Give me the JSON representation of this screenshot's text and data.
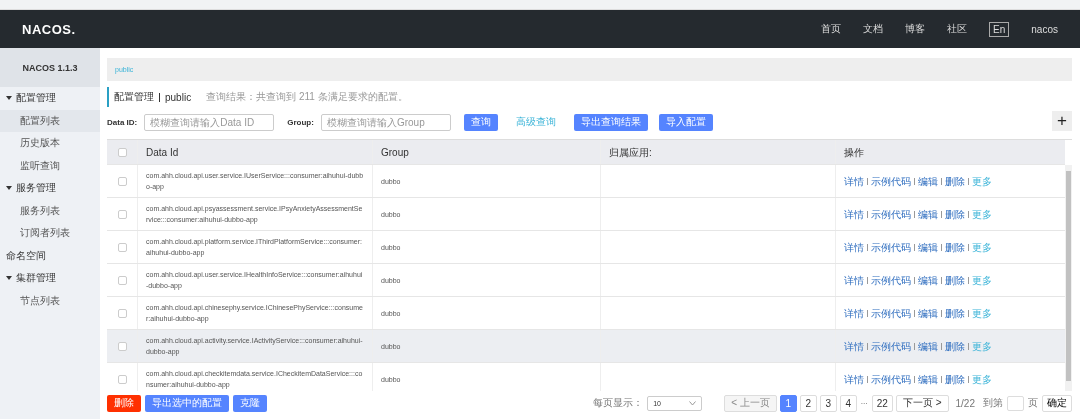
{
  "header": {
    "logo": "NACOS.",
    "nav": [
      {
        "label": "首页",
        "kind": "link"
      },
      {
        "label": "文档",
        "kind": "link"
      },
      {
        "label": "博客",
        "kind": "link"
      },
      {
        "label": "社区",
        "kind": "link"
      },
      {
        "label": "En",
        "kind": "lang"
      },
      {
        "label": "nacos",
        "kind": "user"
      }
    ]
  },
  "sidebar": {
    "title": "NACOS 1.1.3",
    "items": [
      {
        "label": "配置管理",
        "expanded": true,
        "children": [
          {
            "label": "配置列表",
            "selected": true
          },
          {
            "label": "历史版本",
            "selected": false
          },
          {
            "label": "监听查询",
            "selected": false
          }
        ]
      },
      {
        "label": "服务管理",
        "expanded": true,
        "children": [
          {
            "label": "服务列表",
            "selected": false
          },
          {
            "label": "订阅者列表",
            "selected": false
          }
        ]
      },
      {
        "label": "命名空间"
      },
      {
        "label": "集群管理",
        "expanded": true,
        "children": [
          {
            "label": "节点列表",
            "selected": false
          }
        ]
      }
    ]
  },
  "breadcrumb": "public",
  "page_title": {
    "title": "配置管理",
    "namespace": "public",
    "summary": "查询结果：共查询到 211 条满足要求的配置。"
  },
  "search": {
    "fields": [
      {
        "label": "Data ID:",
        "placeholder": "模糊查询请输入Data ID"
      },
      {
        "label": "Group:",
        "placeholder": "模糊查询请输入Group"
      }
    ],
    "buttons": [
      {
        "label": "查询",
        "kind": "primary"
      },
      {
        "label": "高级查询",
        "kind": "link"
      },
      {
        "label": "导出查询结果",
        "kind": "primary"
      },
      {
        "label": "导入配置",
        "kind": "primary"
      }
    ],
    "add_button": "+"
  },
  "table": {
    "columns": [
      "Data Id",
      "Group",
      "归属应用:",
      "操作"
    ],
    "select_all": false,
    "rows": [
      {
        "data_id": "com.ahh.cloud.api.user.service.IUserService:::consumer:aihuhui-dubbo-app",
        "group": "dubbo",
        "checked": false,
        "highlighted": false,
        "actions": [
          {
            "label": "详情",
            "kind": "link"
          },
          {
            "label": "示例代码",
            "kind": "link"
          },
          {
            "label": "编辑",
            "kind": "link"
          },
          {
            "label": "删除",
            "kind": "link"
          },
          {
            "label": "更多",
            "kind": "more"
          }
        ]
      },
      {
        "data_id": "com.ahh.cloud.api.psyassessment.service.IPsyAnxietyAssessmentService:::consumer:aihuhui-dubbo-app",
        "group": "dubbo",
        "checked": false,
        "highlighted": false,
        "actions": [
          {
            "label": "详情",
            "kind": "link"
          },
          {
            "label": "示例代码",
            "kind": "link"
          },
          {
            "label": "编辑",
            "kind": "link"
          },
          {
            "label": "删除",
            "kind": "link"
          },
          {
            "label": "更多",
            "kind": "more"
          }
        ]
      },
      {
        "data_id": "com.ahh.cloud.api.platform.service.IThirdPlatformService:::consumer:aihuhui-dubbo-app",
        "group": "dubbo",
        "checked": false,
        "highlighted": false,
        "actions": [
          {
            "label": "详情",
            "kind": "link"
          },
          {
            "label": "示例代码",
            "kind": "link"
          },
          {
            "label": "编辑",
            "kind": "link"
          },
          {
            "label": "删除",
            "kind": "link"
          },
          {
            "label": "更多",
            "kind": "more"
          }
        ]
      },
      {
        "data_id": "com.ahh.cloud.api.user.service.IHealthInfoService:::consumer:aihuhui-dubbo-app",
        "group": "dubbo",
        "checked": false,
        "highlighted": false,
        "actions": [
          {
            "label": "详情",
            "kind": "link"
          },
          {
            "label": "示例代码",
            "kind": "link"
          },
          {
            "label": "编辑",
            "kind": "link"
          },
          {
            "label": "删除",
            "kind": "link"
          },
          {
            "label": "更多",
            "kind": "more"
          }
        ]
      },
      {
        "data_id": "com.ahh.cloud.api.chinesephy.service.IChinesePhyService:::consumer:aihuhui-dubbo-app",
        "group": "dubbo",
        "checked": false,
        "highlighted": false,
        "actions": [
          {
            "label": "详情",
            "kind": "link"
          },
          {
            "label": "示例代码",
            "kind": "link"
          },
          {
            "label": "编辑",
            "kind": "link"
          },
          {
            "label": "删除",
            "kind": "link"
          },
          {
            "label": "更多",
            "kind": "more"
          }
        ]
      },
      {
        "data_id": "com.ahh.cloud.api.activity.service.IActivityService:::consumer:aihuhui-dubbo-app",
        "group": "dubbo",
        "checked": false,
        "highlighted": true,
        "actions": [
          {
            "label": "详情",
            "kind": "link"
          },
          {
            "label": "示例代码",
            "kind": "link"
          },
          {
            "label": "编辑",
            "kind": "link"
          },
          {
            "label": "删除",
            "kind": "link"
          },
          {
            "label": "更多",
            "kind": "more"
          }
        ]
      },
      {
        "data_id": "com.ahh.cloud.api.checkitemdata.service.ICheckitemDataService:::consumer:aihuhui-dubbo-app",
        "group": "dubbo",
        "checked": false,
        "highlighted": false,
        "actions": [
          {
            "label": "详情",
            "kind": "link"
          },
          {
            "label": "示例代码",
            "kind": "link"
          },
          {
            "label": "编辑",
            "kind": "link"
          },
          {
            "label": "删除",
            "kind": "link"
          },
          {
            "label": "更多",
            "kind": "more"
          }
        ]
      }
    ]
  },
  "footer": {
    "buttons": [
      {
        "label": "删除",
        "kind": "danger"
      },
      {
        "label": "导出选中的配置",
        "kind": "primary"
      },
      {
        "label": "克隆",
        "kind": "primary"
      }
    ],
    "page_size_label": "每页显示：",
    "page_size": "10",
    "pager": [
      {
        "label": "< 上一页",
        "kind": "nav",
        "disabled": true
      },
      {
        "label": "1",
        "kind": "page",
        "selected": true
      },
      {
        "label": "2",
        "kind": "page",
        "selected": false
      },
      {
        "label": "3",
        "kind": "page",
        "selected": false
      },
      {
        "label": "4",
        "kind": "page",
        "selected": false
      },
      {
        "label": "···",
        "kind": "ellipsis"
      },
      {
        "label": "22",
        "kind": "page",
        "selected": false
      },
      {
        "label": "下一页 >",
        "kind": "nav",
        "disabled": false
      }
    ],
    "page_info": "1/22",
    "goto_label": "到第",
    "goto_suffix": "页",
    "confirm": "确定"
  }
}
